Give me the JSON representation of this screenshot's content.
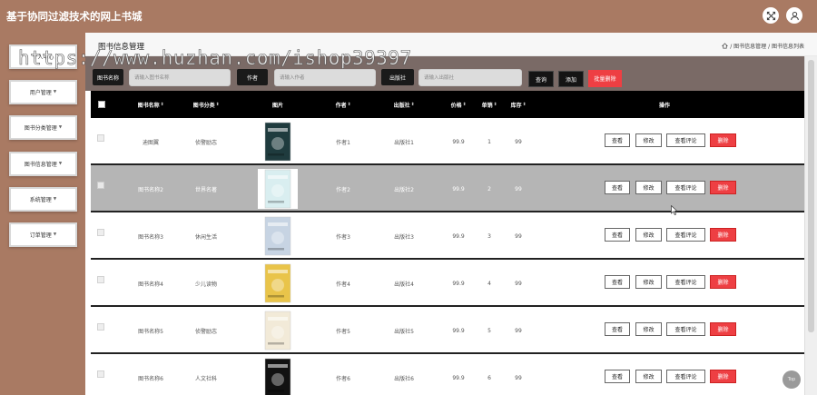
{
  "app": {
    "title": "基于协同过滤技术的网上书城"
  },
  "header": {
    "icons": [
      "fullscreen-icon",
      "user-icon"
    ]
  },
  "sidebar": {
    "items": [
      {
        "label": "个人中心"
      },
      {
        "label": "用户管理"
      },
      {
        "label": "图书分类管理"
      },
      {
        "label": "图书信息管理"
      },
      {
        "label": "系统管理"
      },
      {
        "label": "订单管理"
      }
    ]
  },
  "page": {
    "title": "图书信息管理",
    "breadcrumb": "/ 图书信息管理 / 图书信息列表"
  },
  "search": {
    "name_label": "图书名称",
    "name_placeholder": "请输入图书名称",
    "author_label": "作者",
    "author_placeholder": "请输入作者",
    "publisher_label": "出版社",
    "publisher_placeholder": "请输入出版社",
    "query_button": "查询",
    "add_button": "添加",
    "batch_delete_button": "批量删除"
  },
  "table": {
    "columns": {
      "name": "图书名称",
      "category": "图书分类",
      "image": "图片",
      "author": "作者",
      "publisher": "出版社",
      "price": "价格",
      "sales": "单销",
      "stock": "库存",
      "actions": "操作"
    },
    "sort_glyph": "⇕",
    "actions": {
      "view": "查看",
      "edit": "修改",
      "reviews": "查看评论",
      "delete": "删除"
    },
    "rows": [
      {
        "name": "迪图翼",
        "category": "侦警励志",
        "author": "作者1",
        "publisher": "出版社1",
        "price": "99.9",
        "sales": "1",
        "stock": "99",
        "cover_color": "#1f3b3e"
      },
      {
        "name": "图书名称2",
        "category": "世界名著",
        "author": "作者2",
        "publisher": "出版社2",
        "price": "99.9",
        "sales": "2",
        "stock": "99",
        "cover_color": "#d9eef0"
      },
      {
        "name": "图书名称3",
        "category": "休闲生活",
        "author": "作者3",
        "publisher": "出版社3",
        "price": "99.9",
        "sales": "3",
        "stock": "99",
        "cover_color": "#c7d4e3"
      },
      {
        "name": "图书名称4",
        "category": "少儿读物",
        "author": "作者4",
        "publisher": "出版社4",
        "price": "99.9",
        "sales": "4",
        "stock": "99",
        "cover_color": "#e9c44a"
      },
      {
        "name": "图书名称5",
        "category": "侦警励志",
        "author": "作者5",
        "publisher": "出版社5",
        "price": "99.9",
        "sales": "5",
        "stock": "99",
        "cover_color": "#f2ead8"
      },
      {
        "name": "图书名称6",
        "category": "人文社科",
        "author": "作者6",
        "publisher": "出版社6",
        "price": "99.9",
        "sales": "6",
        "stock": "99",
        "cover_color": "#111111"
      }
    ]
  },
  "scroll_top": {
    "label": "Top"
  },
  "watermark": "https://www.huzhan.com/ishop39397"
}
